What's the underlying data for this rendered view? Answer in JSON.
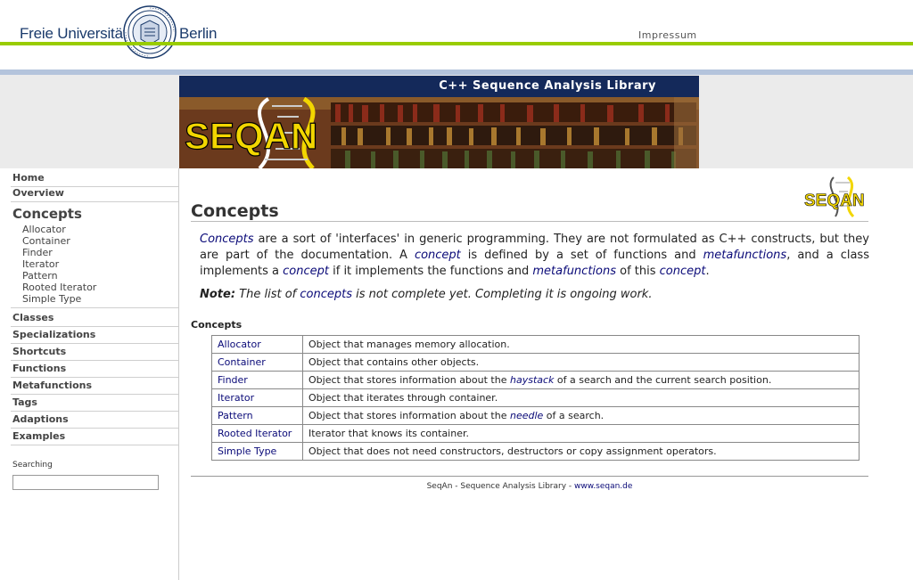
{
  "header": {
    "university_left": "Freie Universität",
    "university_right": "Berlin",
    "impressum": "Impressum"
  },
  "banner": {
    "title": "C++ Sequence Analysis Library",
    "logo_text": "SEQAN"
  },
  "sidebar": {
    "home": "Home",
    "overview": "Overview",
    "current": "Concepts",
    "sub_items": [
      "Allocator",
      "Container",
      "Finder",
      "Iterator",
      "Pattern",
      "Rooted Iterator",
      "Simple Type"
    ],
    "sections": [
      "Classes",
      "Specializations",
      "Shortcuts",
      "Functions",
      "Metafunctions",
      "Tags",
      "Adaptions",
      "Examples"
    ],
    "search_label": "Searching",
    "search_value": ""
  },
  "main": {
    "corner_logo_text": "SEQAN",
    "title": "Concepts",
    "intro": {
      "w1": "Concepts",
      "t1": " are a sort of 'interfaces' in generic programming. They are not formulated as C++ constructs, but they are part of the documentation. A ",
      "w2": "concept",
      "t2": " is defined by a set of functions and ",
      "w3": "metafunctions",
      "t3": ", and a class implements a ",
      "w4": "concept",
      "t4": " if it implements the functions and ",
      "w5": "metafunctions",
      "t5": " of this ",
      "w6": "concept",
      "t6": "."
    },
    "note": {
      "label": "Note:",
      "t1": " The list of ",
      "w1": "concepts",
      "t2": " is not complete yet. Completing it is ongoing work."
    },
    "table_heading": "Concepts",
    "rows": [
      {
        "name": "Allocator",
        "desc_a": "Object that manages memory allocation.",
        "desc_link": "",
        "desc_b": ""
      },
      {
        "name": "Container",
        "desc_a": "Object that contains other objects.",
        "desc_link": "",
        "desc_b": ""
      },
      {
        "name": "Finder",
        "desc_a": "Object that stores information about the ",
        "desc_link": "haystack",
        "desc_b": " of a search and the current search position."
      },
      {
        "name": "Iterator",
        "desc_a": "Object that iterates through container.",
        "desc_link": "",
        "desc_b": ""
      },
      {
        "name": "Pattern",
        "desc_a": "Object that stores information about the ",
        "desc_link": "needle",
        "desc_b": " of a search."
      },
      {
        "name": "Rooted Iterator",
        "desc_a": "Iterator that knows its container.",
        "desc_link": "",
        "desc_b": ""
      },
      {
        "name": "Simple Type",
        "desc_a": "Object that does not need constructors, destructors or copy assignment operators.",
        "desc_link": "",
        "desc_b": ""
      }
    ],
    "footer_text": "SeqAn - Sequence Analysis Library - ",
    "footer_link": "www.seqan.de"
  },
  "colors": {
    "accent_green": "#99cc00",
    "accent_blue": "#b4c4dc",
    "banner_navy": "#14295a",
    "link": "#0a0a78",
    "logo_yellow": "#f2d600"
  }
}
